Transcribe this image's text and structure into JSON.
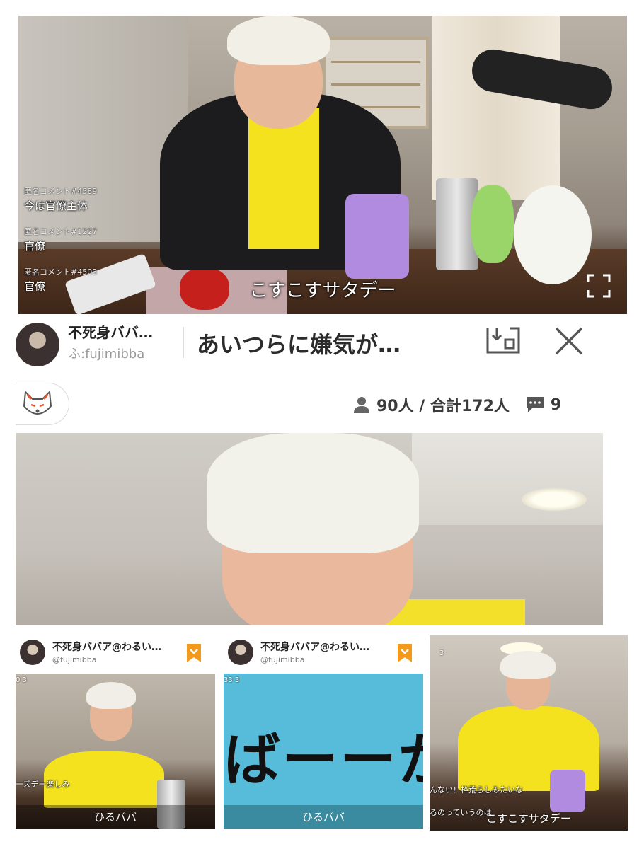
{
  "top_video": {
    "title": "こすこすサタデー",
    "comments": [
      {
        "head": "匿名コメント#4589",
        "body": "今は官僚主体"
      },
      {
        "head": "匿名コメント#1227",
        "body": "官僚"
      },
      {
        "head": "匿名コメント#4503",
        "body": "官僚"
      }
    ],
    "fullscreen_icon": "fullscreen-icon"
  },
  "header": {
    "channel_name": "不死身ババ…",
    "channel_id": "ふ:fujimibba",
    "stream_title": "あいつらに嫌気が…",
    "pip_icon": "picture-in-picture-icon",
    "close_icon": "close-icon"
  },
  "stats": {
    "viewers": "90人 / 合計172人",
    "comments": "9",
    "viewer_icon": "person-icon",
    "comment_icon": "chat-bubble-icon",
    "badge_icon": "fox-mask-icon"
  },
  "cards": [
    {
      "name": "不死身ババア@わるい…",
      "id": "@fujimibba",
      "label": "ひるババ",
      "counter": "0 3",
      "overlay_comment": "ーズデー楽しみ"
    },
    {
      "name": "不死身ババア@わるい…",
      "id": "@fujimibba",
      "label": "ひるババ",
      "counter": "33 3",
      "big_text": "ばーーか"
    },
    {
      "label": "こすこすサタデー",
      "counter": "3",
      "overlay_comment": "んない！枠荒らしみたいな",
      "overlay_comment2": "るのっていうのは"
    }
  ],
  "colors": {
    "accent_orange": "#f39a1c",
    "shirt_yellow": "#f3e21d",
    "teal": "#3a8aa0"
  }
}
